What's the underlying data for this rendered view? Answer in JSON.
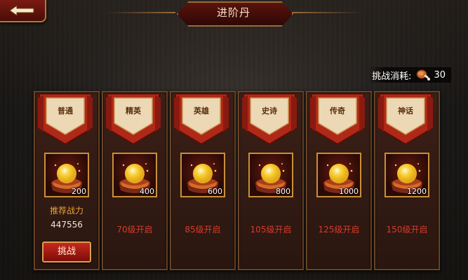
{
  "header": {
    "title": "进阶丹"
  },
  "cost": {
    "label": "挑战消耗:",
    "value": "30",
    "icon": "meat-leg-icon"
  },
  "colors": {
    "accent_gold": "#c8903a",
    "banner_red": "#b02818",
    "unlock_text": "#d83a2a",
    "power_label": "#e8a23a"
  },
  "cards": [
    {
      "tier": "普通",
      "reward_count": "200",
      "power_label": "推荐战力",
      "power_value": "447556",
      "button": "挑战"
    },
    {
      "tier": "精英",
      "reward_count": "400",
      "unlock": "70级开启"
    },
    {
      "tier": "英雄",
      "reward_count": "600",
      "unlock": "85级开启"
    },
    {
      "tier": "史诗",
      "reward_count": "800",
      "unlock": "105级开启"
    },
    {
      "tier": "传奇",
      "reward_count": "1000",
      "unlock": "125级开启"
    },
    {
      "tier": "神话",
      "reward_count": "1200",
      "unlock": "150级开启"
    }
  ]
}
